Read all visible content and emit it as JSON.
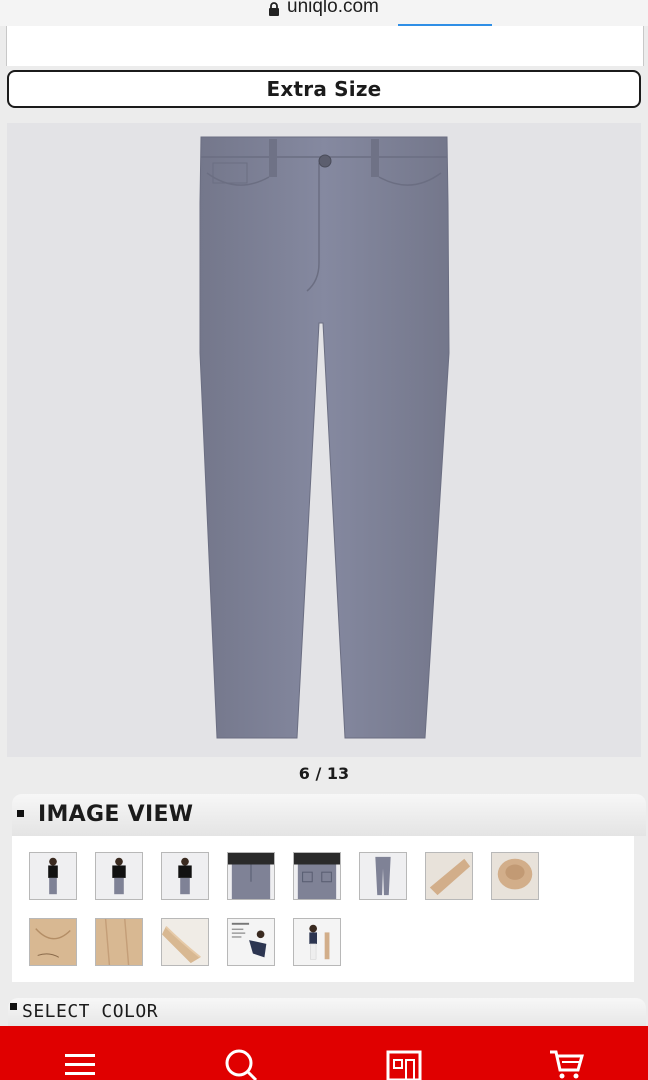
{
  "browser": {
    "url": "uniqlo.com",
    "lock_icon": "lock-icon"
  },
  "product": {
    "size_option_label": "Extra Size",
    "image_counter": "6 / 13",
    "main_image_alt": "pants-photo",
    "pants_color": "#7f8296"
  },
  "image_view": {
    "title": "IMAGE VIEW",
    "thumbnails": [
      {
        "kind": "model-side"
      },
      {
        "kind": "model-front"
      },
      {
        "kind": "model-front-2"
      },
      {
        "kind": "hip-front"
      },
      {
        "kind": "hip-back"
      },
      {
        "kind": "pants-flat"
      },
      {
        "kind": "beige-detail"
      },
      {
        "kind": "beige-waist"
      },
      {
        "kind": "beige-pocket"
      },
      {
        "kind": "beige-fabric"
      },
      {
        "kind": "beige-stretch"
      },
      {
        "kind": "feature-infographic"
      },
      {
        "kind": "styling-shot"
      }
    ]
  },
  "select_color": {
    "title": "SELECT COLOR"
  },
  "bottom_nav": {
    "background": "#e00000",
    "items": [
      {
        "icon": "menu-icon"
      },
      {
        "icon": "search-icon"
      },
      {
        "icon": "store-icon"
      },
      {
        "icon": "cart-icon"
      }
    ]
  }
}
